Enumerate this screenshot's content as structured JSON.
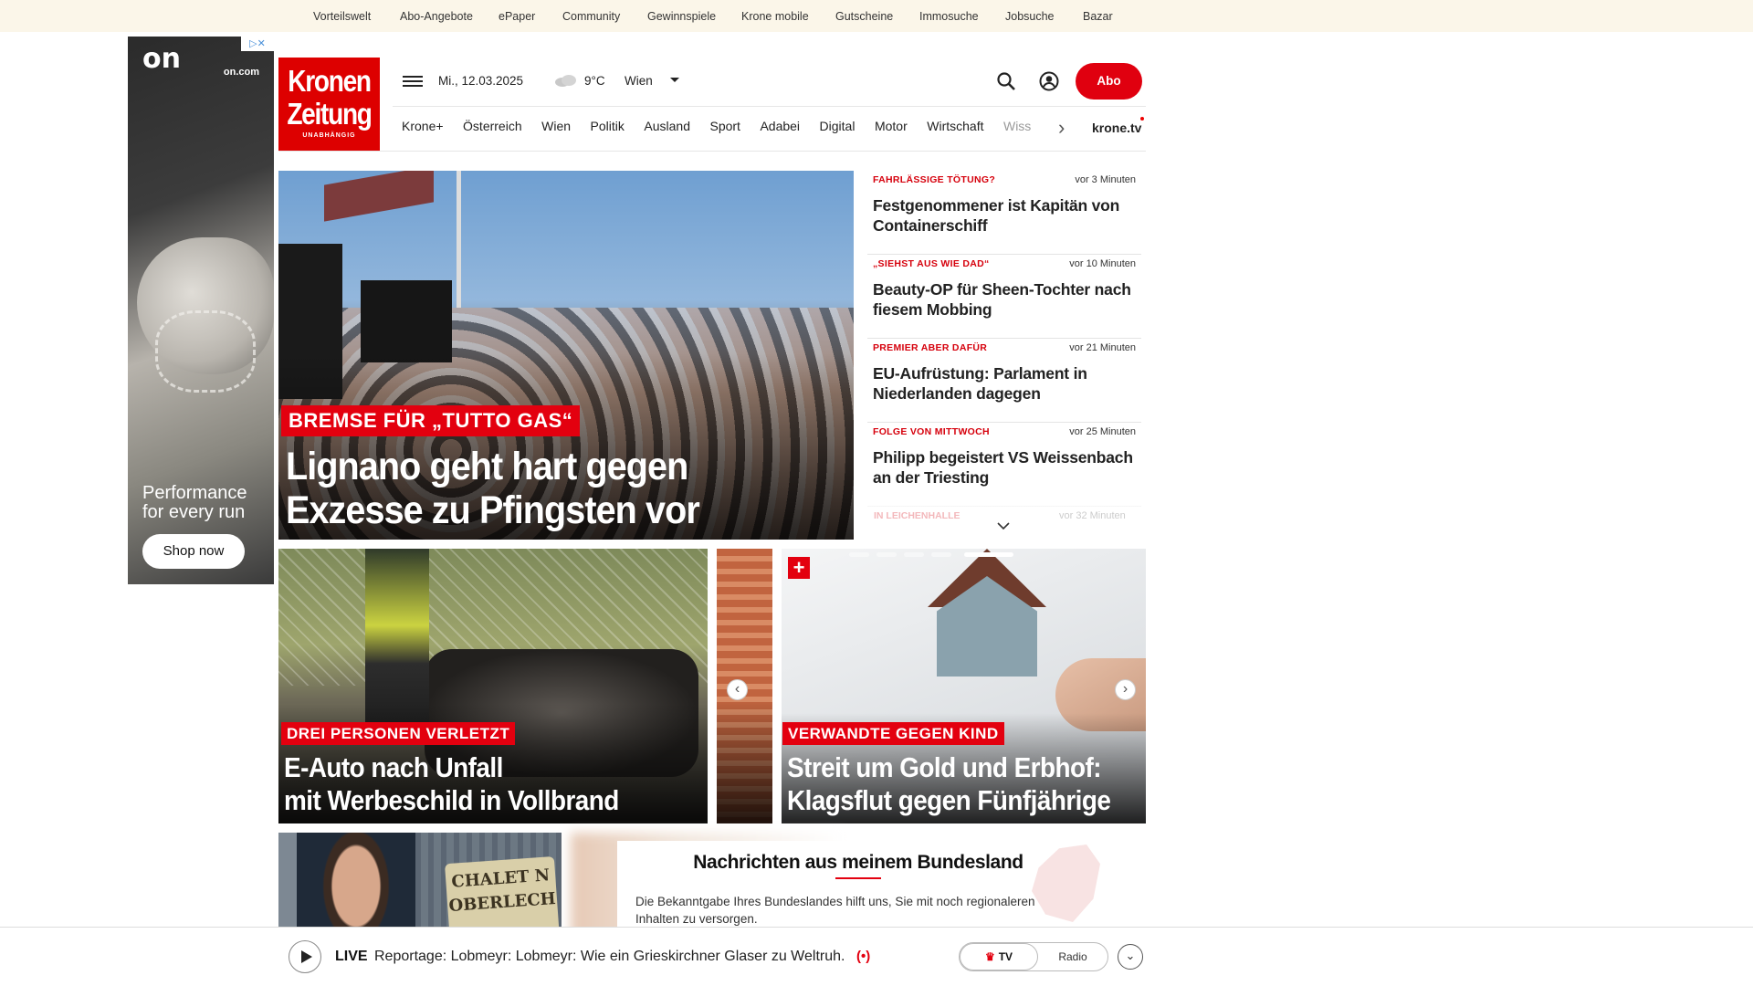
{
  "topbar": {
    "links": [
      "Vorteilswelt",
      "Abo-Angebote",
      "ePaper",
      "Community",
      "Gewinnspiele",
      "Krone mobile",
      "Gutscheine",
      "Immosuche",
      "Jobsuche",
      "Bazar"
    ]
  },
  "ad": {
    "brand": "on",
    "domain": "on.com",
    "tagline": "Performance for every run",
    "cta": "Shop now",
    "close_icon": "ad-info-close-icon"
  },
  "header": {
    "logo_line1": "Kronen",
    "logo_line2": "Zeitung",
    "logo_sub": "UNABHÄNGIG",
    "date": "Mi., 12.03.2025",
    "temperature": "9°C",
    "city": "Wien",
    "abo_label": "Abo",
    "nav": [
      "Krone+",
      "Österreich",
      "Wien",
      "Politik",
      "Ausland",
      "Sport",
      "Adabei",
      "Digital",
      "Motor",
      "Wirtschaft",
      "Wiss"
    ],
    "kronetv": "krone.tv"
  },
  "hero": {
    "kicker": "BREMSE FÜR „TUTTO GAS“",
    "title": "Lignano geht hart gegen Exzesse zu Pfingsten vor"
  },
  "ticker": [
    {
      "kicker": "FAHRLÄSSIGE TÖTUNG?",
      "time": "vor 3 Minuten",
      "headline": "Festgenommener ist Kapitän von Containerschiff"
    },
    {
      "kicker": "„SIEHST AUS WIE DAD“",
      "time": "vor 10 Minuten",
      "headline": "Beauty-OP für Sheen-Tochter nach fiesem Mobbing"
    },
    {
      "kicker": "PREMIER ABER DAFÜR",
      "time": "vor 21 Minuten",
      "headline": "EU-Aufrüstung: Parlament in Niederlanden dagegen"
    },
    {
      "kicker": "FOLGE VON MITTWOCH",
      "time": "vor 25 Minuten",
      "headline": "Philipp begeistert VS Weissenbach an der Triesting"
    }
  ],
  "ticker_more": {
    "kicker": "IN LEICHENHALLE",
    "time": "vor 32 Minuten"
  },
  "cards": {
    "card1": {
      "kicker": "DREI PERSONEN VERLETZT",
      "title_line1": "E-Auto nach Unfall",
      "title_line2": "mit Werbeschild in Vollbrand"
    },
    "card2": {
      "kicker": "VERWANDTE GEGEN KIND",
      "title_line1": "Streit um Gold und Erbhof:",
      "title_line2": "Klagsflut gegen Fünfjährige"
    },
    "card3_sign": "CHALET N OBERLECH"
  },
  "bundesland": {
    "title": "Nachrichten aus meinem Bundesland",
    "text": "Die Bekanntgabe Ihres Bundeslandes hilft uns, Sie mit noch regionaleren Inhalten zu versorgen."
  },
  "livebar": {
    "live_label": "LIVE",
    "text": "Reportage: Lobmeyr: Lobmeyr: Wie ein Grieskirchner Glaser zu Weltruh...",
    "radio_icon": "(•)",
    "tv_label": "TV",
    "radio_label": "Radio"
  },
  "colors": {
    "brand_red": "#e3000f",
    "topbar_bg": "#fbf6e9"
  }
}
